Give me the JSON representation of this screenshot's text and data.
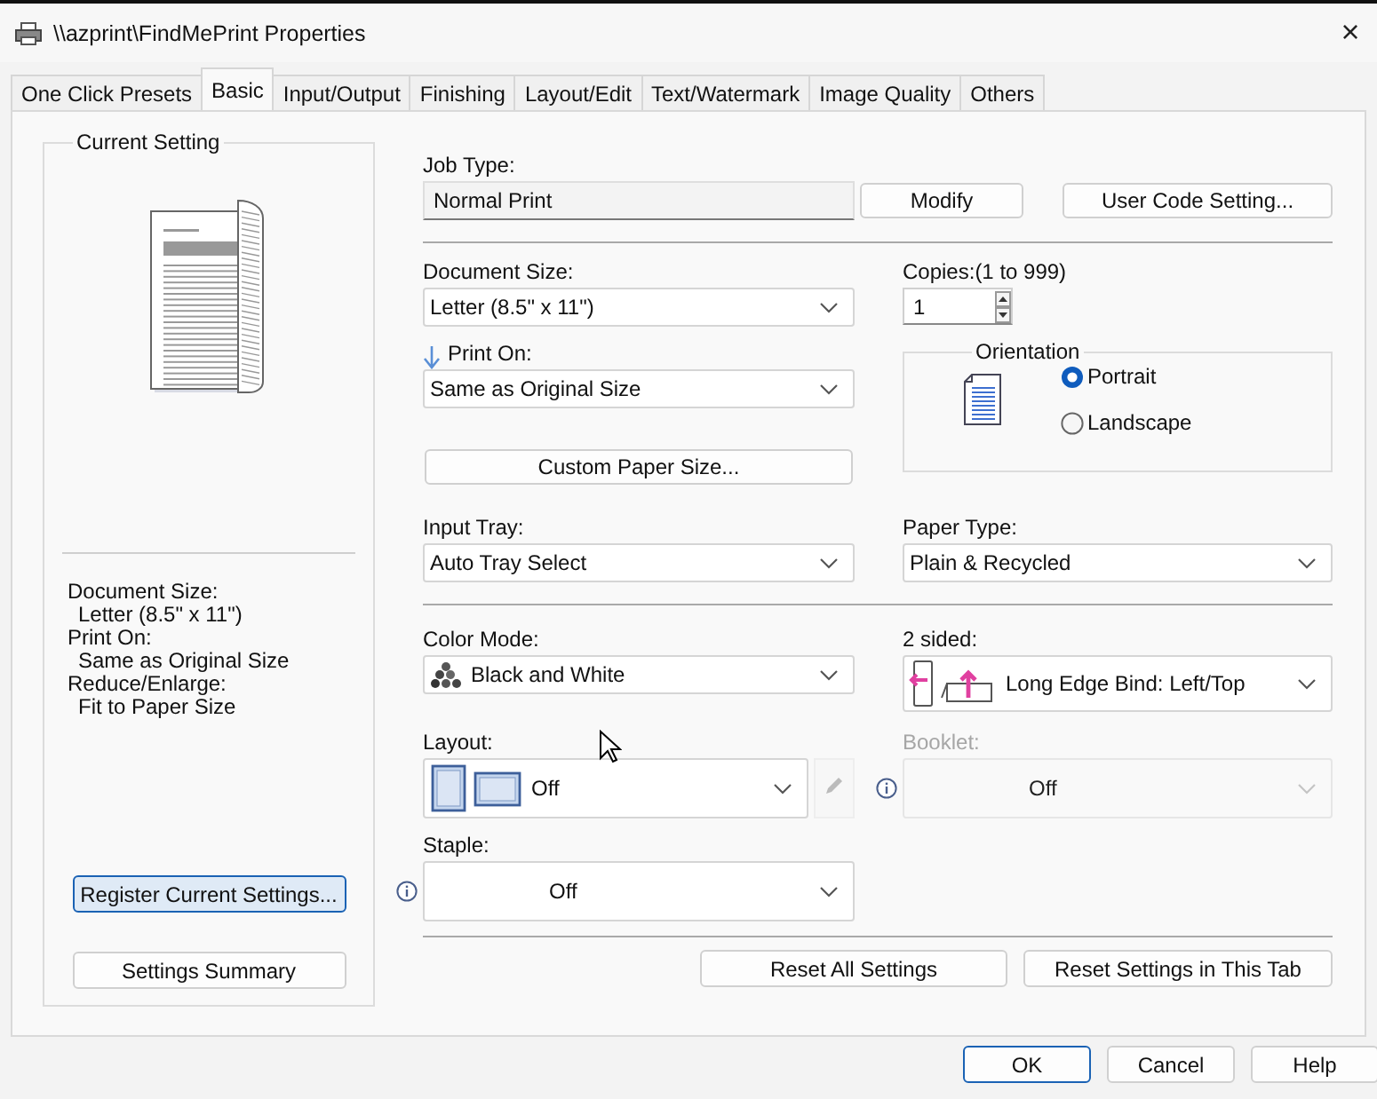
{
  "window": {
    "title": "\\\\azprint\\FindMePrint Properties",
    "close": "×"
  },
  "tabs": [
    {
      "label": "One Click Presets",
      "selected": false
    },
    {
      "label": "Basic",
      "selected": true
    },
    {
      "label": "Input/Output",
      "selected": false
    },
    {
      "label": "Finishing",
      "selected": false
    },
    {
      "label": "Layout/Edit",
      "selected": false
    },
    {
      "label": "Text/Watermark",
      "selected": false
    },
    {
      "label": "Image Quality",
      "selected": false
    },
    {
      "label": "Others",
      "selected": false
    }
  ],
  "current_setting": {
    "title": "Current Setting",
    "summary": [
      {
        "label": "Document Size:",
        "value": "Letter (8.5\" x 11\")"
      },
      {
        "label": "Print On:",
        "value": "Same as Original Size"
      },
      {
        "label": "Reduce/Enlarge:",
        "value": "Fit to Paper Size"
      }
    ],
    "buttons": [
      {
        "label": "Register Current Settings...",
        "focused": true
      },
      {
        "label": "Settings Summary",
        "focused": false
      }
    ]
  },
  "job_type": {
    "label": "Job Type:",
    "value": "Normal Print",
    "buttons": [
      "Modify",
      "User Code Setting..."
    ]
  },
  "document_size": {
    "label": "Document Size:",
    "value": "Letter (8.5\" x 11\")"
  },
  "copies": {
    "label": "Copies:(1 to 999)",
    "value": "1"
  },
  "print_on": {
    "label": "Print On:",
    "value": "Same as Original Size"
  },
  "orientation": {
    "title": "Orientation",
    "options": [
      {
        "label": "Portrait",
        "selected": true
      },
      {
        "label": "Landscape",
        "selected": false
      }
    ]
  },
  "custom_paper_size": "Custom Paper Size...",
  "input_tray": {
    "label": "Input Tray:",
    "value": "Auto Tray Select"
  },
  "paper_type": {
    "label": "Paper Type:",
    "value": "Plain & Recycled"
  },
  "color_mode": {
    "label": "Color Mode:",
    "value": "Black and White"
  },
  "two_sided": {
    "label": "2 sided:",
    "value": "Long Edge Bind: Left/Top"
  },
  "layout": {
    "label": "Layout:",
    "value": "Off"
  },
  "booklet": {
    "label": "Booklet:",
    "value": "Off",
    "disabled": true
  },
  "staple": {
    "label": "Staple:",
    "value": "Off"
  },
  "reset_buttons": [
    "Reset All Settings",
    "Reset Settings in This Tab"
  ],
  "dialog_buttons": [
    {
      "label": "OK",
      "focused": true
    },
    {
      "label": "Cancel",
      "focused": false
    },
    {
      "label": "Help",
      "focused": false
    }
  ]
}
